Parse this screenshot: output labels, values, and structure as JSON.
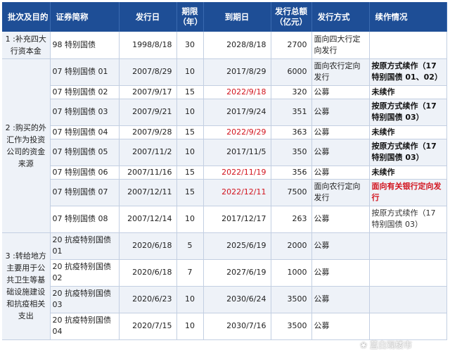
{
  "headers": {
    "purpose": "批次及目的",
    "name": "证券简称",
    "issue_date": "发行日",
    "term_line1": "期限",
    "term_line2": "（年）",
    "maturity": "到期日",
    "amount_line1": "发行总额",
    "amount_line2": "（亿元）",
    "method": "发行方式",
    "renewal": "续作情况"
  },
  "groups": [
    {
      "label_lines": [
        "1 :补充四大",
        "行资本金"
      ]
    },
    {
      "label_lines": [
        "2 :购买的外",
        "汇作为投资",
        "公司的资金",
        "来源"
      ]
    },
    {
      "label_lines": [
        "3 :转给地方",
        "主要用于公",
        "共卫生等基",
        "础设施建设",
        "和抗疫相关",
        "支出"
      ]
    }
  ],
  "rows": [
    {
      "name": "98 特别国债",
      "issue": "1998/8/18",
      "term": "30",
      "maturity": "2028/8/18",
      "amount": "2700",
      "method": "面向四大行定向发行",
      "renewal": ""
    },
    {
      "name": "07 特别国债 01",
      "issue": "2007/8/29",
      "term": "10",
      "maturity": "2017/8/29",
      "amount": "6000",
      "method": "面向农行定向发行",
      "renewal": "按原方式续作（17 特别国债 01、02）"
    },
    {
      "name": "07 特别国债 02",
      "issue": "2007/9/17",
      "term": "15",
      "maturity": "2022/9/18",
      "amount": "320",
      "method": "公募",
      "renewal": "未续作"
    },
    {
      "name": "07 特别国债 03",
      "issue": "2007/9/21",
      "term": "10",
      "maturity": "2017/9/24",
      "amount": "351",
      "method": "公募",
      "renewal": "按原方式续作（17 特别国债 03）"
    },
    {
      "name": "07 特别国债 04",
      "issue": "2007/9/28",
      "term": "15",
      "maturity": "2022/9/29",
      "amount": "363",
      "method": "公募",
      "renewal": "未续作"
    },
    {
      "name": "07 特别国债 05",
      "issue": "2007/11/2",
      "term": "10",
      "maturity": "2017/11/5",
      "amount": "350",
      "method": "公募",
      "renewal": "按原方式续作（17 特别国债 03）"
    },
    {
      "name": "07 特别国债 06",
      "issue": "2007/11/16",
      "term": "15",
      "maturity": "2022/11/19",
      "amount": "356",
      "method": "公募",
      "renewal": "未续作"
    },
    {
      "name": "07 特别国债 07",
      "issue": "2007/12/11",
      "term": "15",
      "maturity": "2022/12/11",
      "amount": "7500",
      "method": "面向农行定向发行",
      "renewal": "面向有关银行定向发行"
    },
    {
      "name": "07 特别国债 08",
      "issue": "2007/12/14",
      "term": "10",
      "maturity": "2017/12/17",
      "amount": "263",
      "method": "公募",
      "renewal": "按原方式续作（17 特别国债 03）"
    },
    {
      "name": "20 抗疫特别国债 01",
      "issue": "2020/6/18",
      "term": "5",
      "maturity": "2025/6/19",
      "amount": "2000",
      "method": "公募",
      "renewal": ""
    },
    {
      "name": "20 抗疫特别国债 02",
      "issue": "2020/6/18",
      "term": "7",
      "maturity": "2027/6/19",
      "amount": "1000",
      "method": "公募",
      "renewal": ""
    },
    {
      "name": "20 抗疫特别国债 03",
      "issue": "2020/6/23",
      "term": "10",
      "maturity": "2030/6/24",
      "amount": "3500",
      "method": "公募",
      "renewal": ""
    },
    {
      "name": "20 抗疫特别国债 04",
      "issue": "2020/7/15",
      "term": "10",
      "maturity": "2030/7/16",
      "amount": "3500",
      "method": "公募",
      "renewal": ""
    }
  ],
  "watermark": "蓝白观楼市",
  "colors": {
    "header_bg": "#1e4e96",
    "highlight_red": "#d2141e",
    "shade": "#eef2f8"
  }
}
